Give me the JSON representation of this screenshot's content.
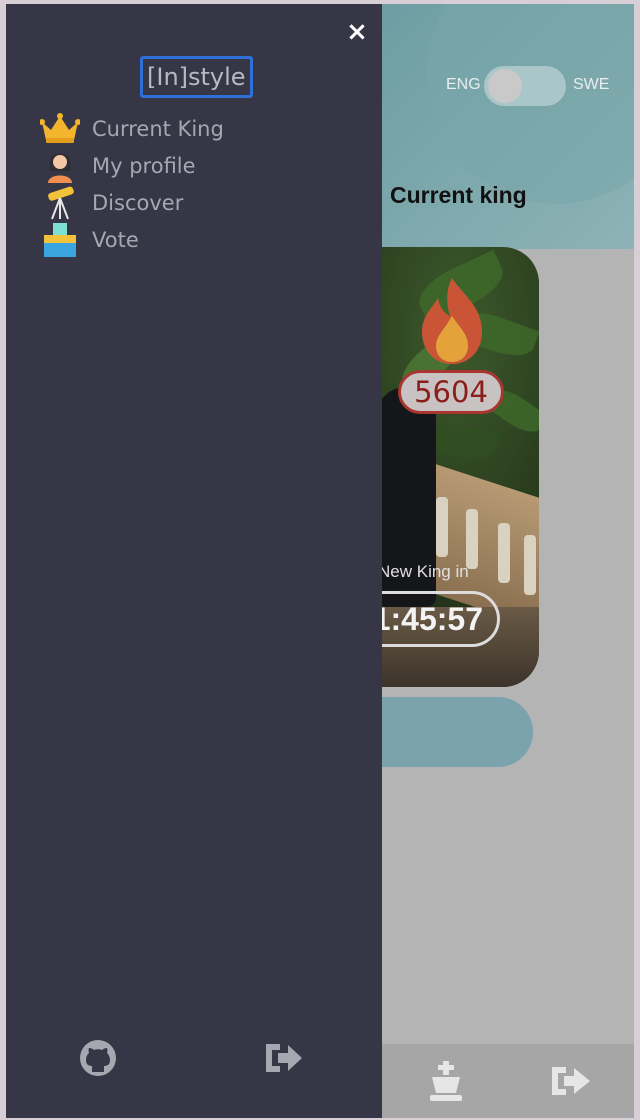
{
  "app": {
    "brand": "[In]style",
    "language": {
      "left_label": "ENG",
      "right_label": "SWE"
    },
    "section_title": "Current king",
    "king": {
      "score": "5604",
      "countdown_label": "New King in",
      "countdown_value": "1:45:57"
    }
  },
  "drawer": {
    "close_label": "×",
    "menu": [
      {
        "label": "Current King",
        "icon": "crown-icon"
      },
      {
        "label": "My profile",
        "icon": "avatar-icon"
      },
      {
        "label": "Discover",
        "icon": "telescope-icon"
      },
      {
        "label": "Vote",
        "icon": "ballot-box-icon"
      }
    ],
    "footer": [
      {
        "icon": "github-icon"
      },
      {
        "icon": "logout-icon"
      }
    ]
  },
  "bottom_nav": [
    {
      "icon": "chess-king-icon"
    },
    {
      "icon": "logout-icon"
    }
  ],
  "colors": {
    "drawer_bg": "#363646",
    "brand_border": "#2f6fd8",
    "score_border": "#a8362f",
    "header_teal": "#6e9ea3"
  }
}
